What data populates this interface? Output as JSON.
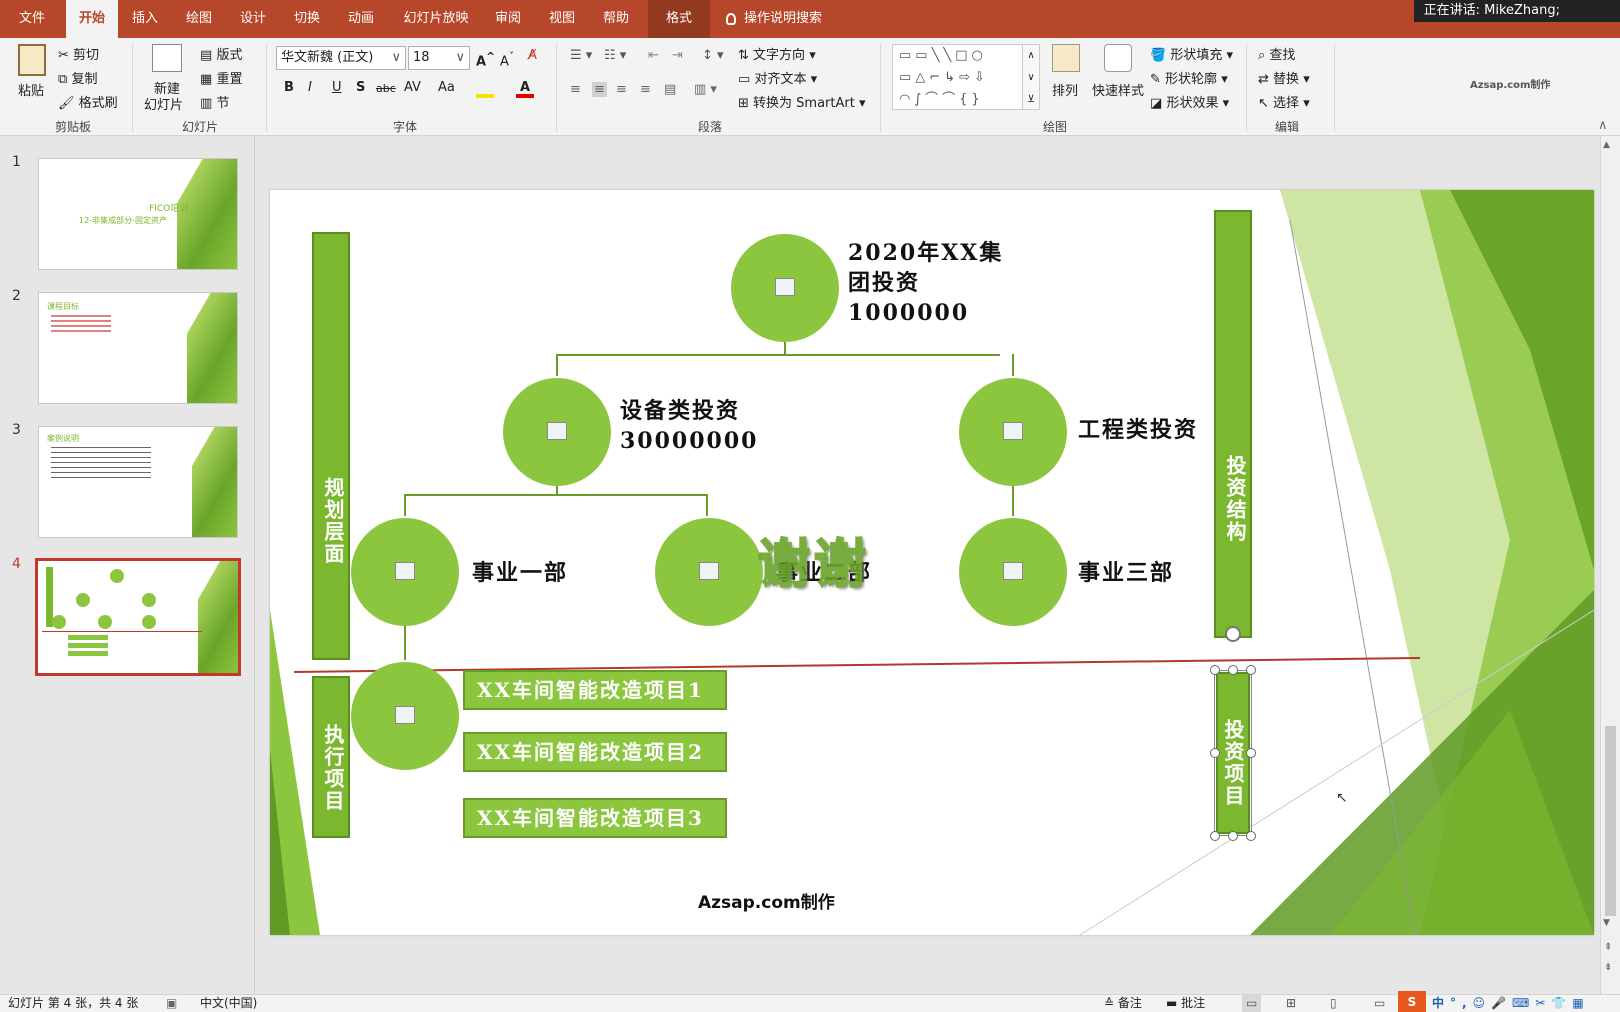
{
  "tabs": [
    {
      "label": "文件"
    },
    {
      "label": "开始"
    },
    {
      "label": "插入"
    },
    {
      "label": "绘图"
    },
    {
      "label": "设计"
    },
    {
      "label": "切换"
    },
    {
      "label": "动画"
    },
    {
      "label": "幻灯片放映"
    },
    {
      "label": "审阅"
    },
    {
      "label": "视图"
    },
    {
      "label": "帮助"
    },
    {
      "label": "格式"
    }
  ],
  "search_tell": "操作说明搜索",
  "speaking": "正在讲话: MikeZhang;",
  "ribbon": {
    "clipboard": {
      "paste": "粘贴",
      "cut": "剪切",
      "copy": "复制",
      "format_painter": "格式刷",
      "label": "剪贴板"
    },
    "slides": {
      "new_slide_line1": "新建",
      "new_slide_line2": "幻灯片",
      "layout": "版式",
      "reset": "重置",
      "section": "节",
      "label": "幻灯片"
    },
    "font": {
      "family": "华文新魏 (正文)",
      "size": "18",
      "bold": "B",
      "italic": "I",
      "underline": "U",
      "shadow": "S",
      "strike": "abc",
      "spacing": "AV",
      "case": "Aa",
      "label": "字体"
    },
    "paragraph": {
      "text_direction": "文字方向",
      "align_text": "对齐文本",
      "convert_smartart": "转换为 SmartArt",
      "label": "段落"
    },
    "drawing": {
      "arrange": "排列",
      "quick_styles": "快速样式",
      "shape_fill": "形状填充",
      "shape_outline": "形状轮廓",
      "shape_effects": "形状效果",
      "label": "绘图"
    },
    "editing": {
      "find": "查找",
      "replace": "替换",
      "select": "选择",
      "label": "编辑"
    }
  },
  "watermark_ribbon": "Azsap.com制作",
  "thumbnails": [
    {
      "num": "1",
      "title": "FICO培训",
      "subtitle": "12-非集成部分-固定资产"
    },
    {
      "num": "2",
      "title": "课程目标"
    },
    {
      "num": "3",
      "title": "案例说明"
    },
    {
      "num": "4"
    }
  ],
  "slide": {
    "left_top_bar": "规划层面",
    "left_bottom_bar": "执行项目",
    "right_top_bar": "投资结构",
    "right_bottom_bar": "投资项目",
    "root_line1": "2020年XX集",
    "root_line2": "团投资",
    "root_line3": "1000000",
    "equip_line1": "设备类投资",
    "equip_line2": "30000000",
    "eng": "工程类投资",
    "dept1": "事业一部",
    "dept2": "事业二部",
    "dept3": "事业三部",
    "thanks": "谢谢",
    "proj1": "XX车间智能改造项目1",
    "proj2": "XX车间智能改造项目2",
    "proj3": "XX车间智能改造项目3",
    "footer": "Azsap.com制作"
  },
  "status": {
    "slide_info": "幻灯片 第 4 张，共 4 张",
    "language": "中文(中国)",
    "notes": "备注",
    "comments": "批注"
  },
  "colors": {
    "accent": "#b7472a",
    "green": "#8cc63f",
    "dark_green": "#5a8e1e"
  }
}
